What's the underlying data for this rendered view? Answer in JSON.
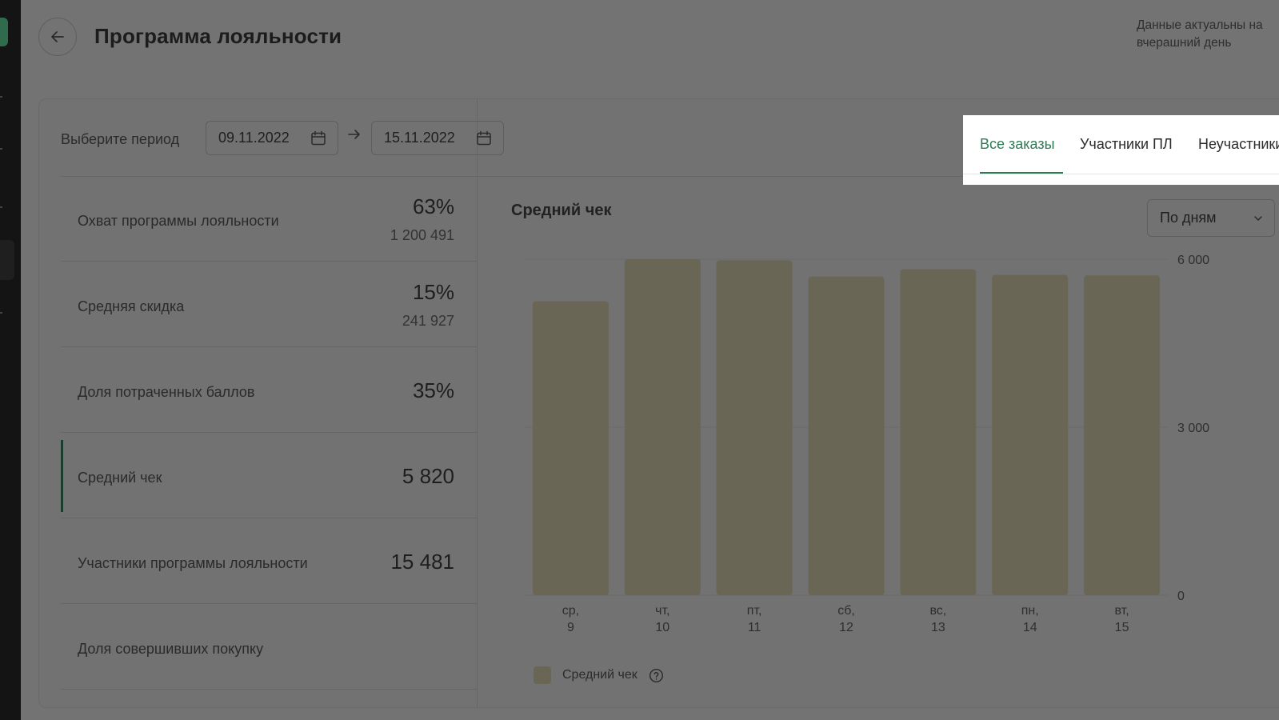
{
  "header": {
    "title": "Программа лояльности",
    "data_note_line1": "Данные актуальны на",
    "data_note_line2": "вчерашний день"
  },
  "period": {
    "label": "Выберите период",
    "date_from": "09.11.2022",
    "date_to": "15.11.2022"
  },
  "metrics": [
    {
      "label": "Охват программы лояльности",
      "value": "63%",
      "sub": "1 200 491"
    },
    {
      "label": "Средняя скидка",
      "value": "15%",
      "sub": "241 927"
    },
    {
      "label": "Доля потраченных баллов",
      "value": "35%",
      "sub": ""
    },
    {
      "label": "Средний чек",
      "value": "5 820",
      "sub": "",
      "selected": true
    },
    {
      "label": "Участники программы лояльности",
      "value": "15 481",
      "sub": ""
    },
    {
      "label": "Доля совершивших покупку",
      "value": "",
      "sub": ""
    }
  ],
  "tabs": [
    {
      "label": "Все заказы",
      "active": true
    },
    {
      "label": "Участники ПЛ",
      "active": false
    },
    {
      "label": "Неучастники",
      "active": false
    }
  ],
  "chart": {
    "title": "Средний чек",
    "granularity": "По дням",
    "legend_label": "Средний чек"
  },
  "icons": {
    "back": "arrow-left-icon",
    "calendar": "calendar-icon",
    "separator": "arrow-right-icon",
    "dropdown": "chevron-down-icon",
    "help": "question-circle-icon"
  },
  "colors": {
    "accent": "#2f7a56",
    "bar": "#6a6656",
    "overlay_bg": "#737373"
  },
  "chart_data": {
    "type": "bar",
    "categories": [
      "ср, 9",
      "чт, 10",
      "пт, 11",
      "сб, 12",
      "вс, 13",
      "пн, 14",
      "вт, 15"
    ],
    "category_lines": [
      [
        "ср,",
        "9"
      ],
      [
        "чт,",
        "10"
      ],
      [
        "пт,",
        "11"
      ],
      [
        "сб,",
        "12"
      ],
      [
        "вс,",
        "13"
      ],
      [
        "пн,",
        "14"
      ],
      [
        "вт,",
        "15"
      ]
    ],
    "series": [
      {
        "name": "Средний чек",
        "values": [
          5250,
          6000,
          5980,
          5690,
          5820,
          5720,
          5710
        ]
      }
    ],
    "ylim": [
      0,
      6000
    ],
    "yticks": [
      0,
      3000,
      6000
    ],
    "ytick_labels": [
      "0",
      "3 000",
      "6 000"
    ],
    "grid": true,
    "legend_position": "bottom-left",
    "title": "Средний чек"
  }
}
